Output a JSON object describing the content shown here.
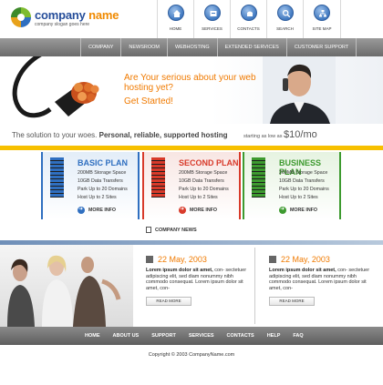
{
  "header": {
    "brand_part1": "company",
    "brand_part2": "name",
    "slogan": "company slogan goes here"
  },
  "top_nav": [
    {
      "label": "HOME",
      "icon": "home-icon"
    },
    {
      "label": "SERVICES",
      "icon": "services-icon"
    },
    {
      "label": "CONTACTS",
      "icon": "contacts-icon"
    },
    {
      "label": "SEARCH",
      "icon": "search-icon"
    },
    {
      "label": "SITE MAP",
      "icon": "sitemap-icon"
    }
  ],
  "main_nav": [
    "COMPANY",
    "NEWSROOM",
    "WEBHOSTING",
    "EXTENDED SERVICES",
    "CUSTOMER SUPPORT"
  ],
  "banner": {
    "headline": "Are Your serious about your web hosting yet?",
    "cta": "Get Started!"
  },
  "tagline": {
    "lead": "The solution to your woes.",
    "bold": "Personal, reliable, supported hosting",
    "price_prefix": "starting as low as",
    "price": "$10/mo"
  },
  "plans": [
    {
      "title": "BASIC PLAN",
      "color": "#2f6fc0",
      "bg": "#e3edf8",
      "features": [
        "200MB Storage Space",
        "10GB Data Transfers",
        "Park Up to 20 Domains",
        "Host Up to 2 Sites"
      ],
      "more": "MORE INFO"
    },
    {
      "title": "SECOND PLAN",
      "color": "#d83a2a",
      "bg": "#f8e6e3",
      "features": [
        "200MB Storage Space",
        "10GB Data Transfers",
        "Park Up to 20 Domains",
        "Host Up to 2 Sites"
      ],
      "more": "MORE INFO"
    },
    {
      "title": "BUSINESS PLAN",
      "color": "#3d9a2f",
      "bg": "#e6f3e1",
      "features": [
        "200MB Storage Space",
        "10GB Data Transfers",
        "Park Up to 20 Domains",
        "Host Up to 2 Sites"
      ],
      "more": "MORE INFO"
    }
  ],
  "news": {
    "section_title": "COMPANY NEWS",
    "items": [
      {
        "date": "22 May, 2003",
        "lead": "Lorem ipsum dolor sit amet,",
        "body": "con- sectetuer adipiscing elit, sed diam nonummy nibh commodo consequat.",
        "tail": "Lorem ipsum dolor sit amet, con-",
        "read_more": "READ MORE"
      },
      {
        "date": "22 May, 2003",
        "lead": "Lorem ipsum dolor sit amet,",
        "body": "con- sectetuer adipiscing elit, sed diam nonummy nibh commodo consequat.",
        "tail": "Lorem ipsum dolor sit amet, con-",
        "read_more": "READ MORE"
      }
    ]
  },
  "footer_nav": [
    "HOME",
    "ABOUT US",
    "SUPPORT",
    "SERVICES",
    "CONTACTS",
    "HELP",
    "FAQ"
  ],
  "copyright": "Copyright © 2003 CompanyName.com"
}
